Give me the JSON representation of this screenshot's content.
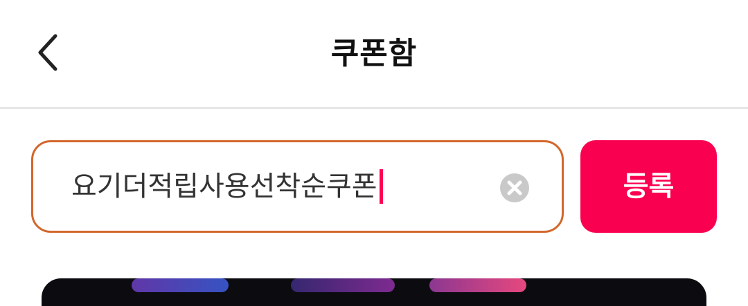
{
  "header": {
    "title": "쿠폰함",
    "back_icon": "chevron-left-icon"
  },
  "coupon_form": {
    "input_value": "요기더적립사용선착순쿠폰",
    "clear_icon": "clear-circle-icon",
    "register_label": "등록"
  },
  "colors": {
    "accent": "#fa0050",
    "input_border": "#d2672c",
    "caret": "#ff0055",
    "clear_icon_bg": "#c9c9c9"
  }
}
